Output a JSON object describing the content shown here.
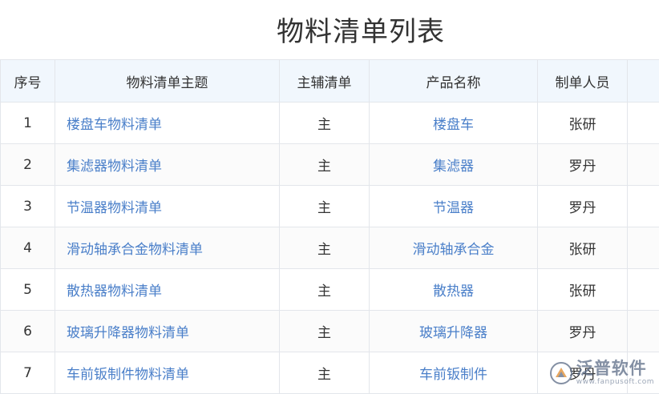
{
  "title": "物料清单列表",
  "columns": [
    "序号",
    "物料清单主题",
    "主辅清单",
    "产品名称",
    "制单人员"
  ],
  "rows": [
    {
      "no": "1",
      "topic": "楼盘车物料清单",
      "type": "主",
      "product": "楼盘车",
      "maker": "张研"
    },
    {
      "no": "2",
      "topic": "集滤器物料清单",
      "type": "主",
      "product": "集滤器",
      "maker": "罗丹"
    },
    {
      "no": "3",
      "topic": "节温器物料清单",
      "type": "主",
      "product": "节温器",
      "maker": "罗丹"
    },
    {
      "no": "4",
      "topic": "滑动轴承合金物料清单",
      "type": "主",
      "product": "滑动轴承合金",
      "maker": "张研"
    },
    {
      "no": "5",
      "topic": "散热器物料清单",
      "type": "主",
      "product": "散热器",
      "maker": "张研"
    },
    {
      "no": "6",
      "topic": "玻璃升降器物料清单",
      "type": "主",
      "product": "玻璃升降器",
      "maker": "罗丹"
    },
    {
      "no": "7",
      "topic": "车前钣制件物料清单",
      "type": "主",
      "product": "车前钣制件",
      "maker": "罗丹"
    }
  ],
  "watermark": {
    "name": "泛普软件",
    "url": "www.fanpusoft.com"
  },
  "colors": {
    "link": "#4a7fc9",
    "header_bg": "#f1f7fd",
    "border": "#e3e6eb"
  }
}
